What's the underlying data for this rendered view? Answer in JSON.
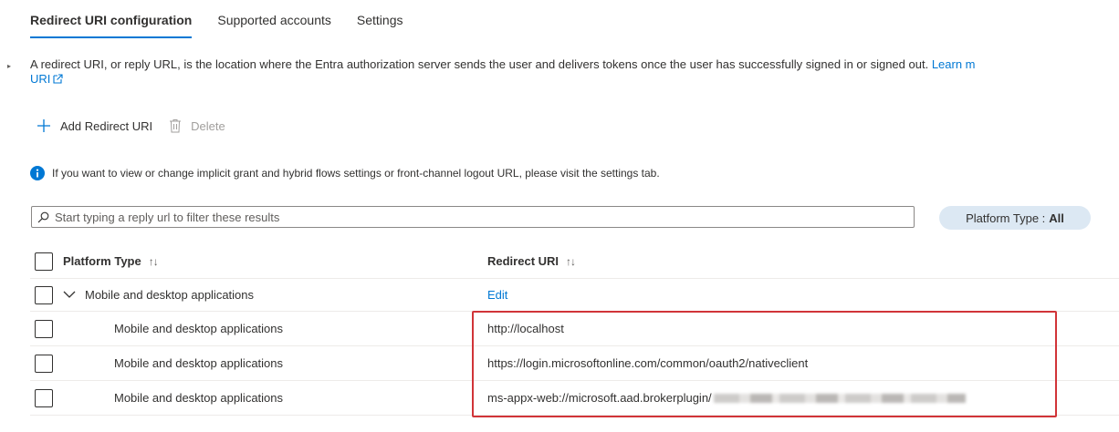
{
  "tabs": [
    {
      "label": "Redirect URI configuration",
      "active": true
    },
    {
      "label": "Supported accounts",
      "active": false
    },
    {
      "label": "Settings",
      "active": false
    }
  ],
  "description": {
    "text": "A redirect URI, or reply URL, is the location where the Entra authorization server sends the user and delivers tokens once the user has successfully signed in or signed out.",
    "link_text": "Learn m",
    "link_line2": "URI"
  },
  "toolbar": {
    "add_label": "Add Redirect URI",
    "delete_label": "Delete"
  },
  "info": {
    "text": "If you want to view or change implicit grant and hybrid flows settings or front-channel logout URL, please visit the settings tab."
  },
  "filter": {
    "placeholder": "Start typing a reply url to filter these results",
    "value": ""
  },
  "platform_filter": {
    "label": "Platform Type :",
    "value": "All"
  },
  "table": {
    "headers": {
      "platform_type": "Platform Type",
      "redirect_uri": "Redirect URI",
      "sort_glyph": "↑↓"
    },
    "group": {
      "label": "Mobile and desktop applications",
      "action": "Edit"
    },
    "rows": [
      {
        "platform": "Mobile and desktop applications",
        "uri": "http://localhost"
      },
      {
        "platform": "Mobile and desktop applications",
        "uri": "https://login.microsoftonline.com/common/oauth2/nativeclient"
      },
      {
        "platform": "Mobile and desktop applications",
        "uri": "ms-appx-web://microsoft.aad.brokerplugin/"
      }
    ]
  },
  "colors": {
    "accent": "#0078d4",
    "highlight": "#d13438",
    "pill_bg": "#dce8f3"
  }
}
